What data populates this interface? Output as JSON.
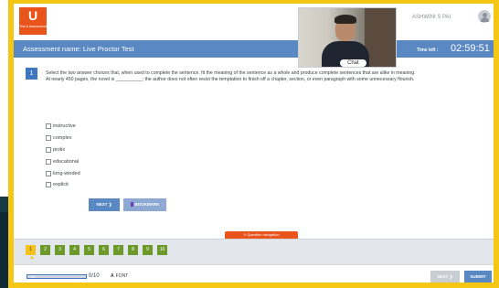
{
  "app": {
    "logo_mark": "U",
    "logo_tagline": "Test & Assessment",
    "brand_color": "#e8541c"
  },
  "header": {
    "user_name": "ASHWINI S PAI",
    "chat_label": "Chat"
  },
  "assessment": {
    "name_label": "Assessment name: Live Proctor Test",
    "time_left_label": "Time left :",
    "timer": "02:59:51"
  },
  "question": {
    "number": "1",
    "instruction": "Select the two answer choices that, when used to complete the sentence, fit the meaning of the sentence as a whole and produce complete sentences that are alike in meaning.",
    "prompt": "At nearly 450 pages, the novel is __________; the author does not often resist the temptation to finish off a chapter, section, or even paragraph with some unnecessary flourish.",
    "options": [
      "instructive",
      "complex",
      "prolix",
      "educational",
      "long-winded",
      "explicit"
    ]
  },
  "actions": {
    "next_label": "NEXT ❯",
    "bookmark_label": "BOOKMARK"
  },
  "navigation": {
    "toggle_label": "∨ Question navigation",
    "questions": [
      "1",
      "2",
      "3",
      "4",
      "5",
      "6",
      "7",
      "8",
      "9",
      "10"
    ],
    "current": 1
  },
  "footer": {
    "progress_text": "0%",
    "progress_percent": 0,
    "answered_count": "0/10",
    "font_label": "FONT",
    "next_label": "NEXT ❯",
    "submit_label": "SUBMIT"
  }
}
